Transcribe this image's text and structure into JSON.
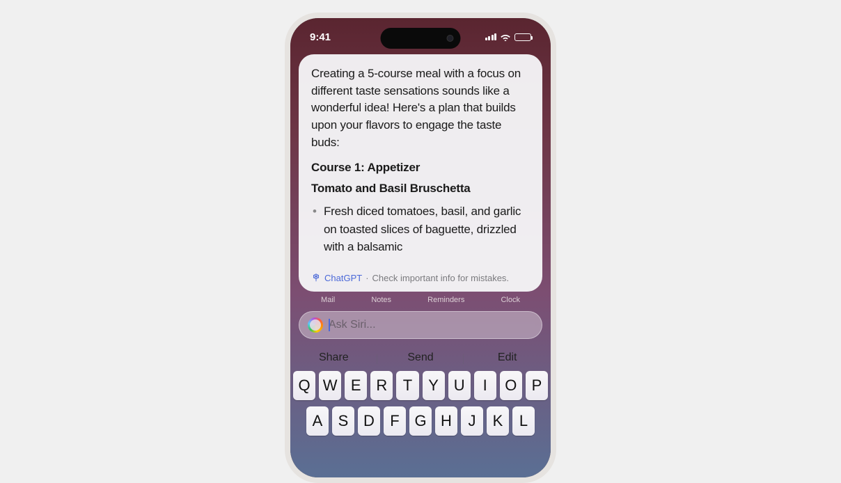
{
  "status": {
    "time": "9:41"
  },
  "card": {
    "intro": "Creating a 5-course meal with a focus on different taste sensations sounds like a wonderful idea! Here's a plan that builds upon your flavors to engage the taste buds:",
    "course_heading": "Course 1: Appetizer",
    "dish": "Tomato and Basil Bruschetta",
    "bullet": "Fresh diced tomatoes, basil, and garlic on toasted slices of baguette, drizzled with a balsamic",
    "gpt_label": "ChatGPT",
    "disclaimer": "Check important info for mistakes."
  },
  "apps": [
    "Mail",
    "Notes",
    "Reminders",
    "Clock"
  ],
  "siri": {
    "placeholder": "Ask Siri..."
  },
  "suggestions": [
    "Share",
    "Send",
    "Edit"
  ],
  "keyboard": {
    "row1": [
      "Q",
      "W",
      "E",
      "R",
      "T",
      "Y",
      "U",
      "I",
      "O",
      "P"
    ],
    "row2": [
      "A",
      "S",
      "D",
      "F",
      "G",
      "H",
      "J",
      "K",
      "L"
    ]
  }
}
